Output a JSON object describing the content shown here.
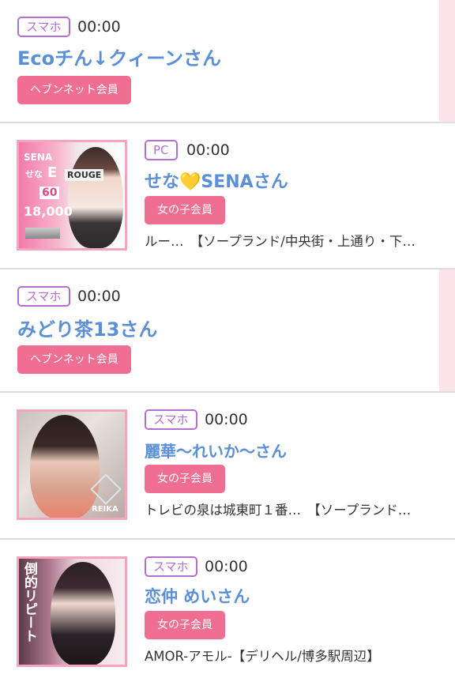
{
  "accent_color": "#f06e92",
  "name_color": "#5b8fd6",
  "badge_color": "#b46fd2",
  "entries": [
    {
      "device": "スマホ",
      "time": "00:00",
      "name": "Ecoチん↓クィーンさん",
      "member": "ヘブンネット会員",
      "shop": ""
    },
    {
      "device": "PC",
      "time": "00:00",
      "name": "せな💛SENAさん",
      "member": "女の子会員",
      "shop": "ルー…　【ソープランド/中央街・上通り・下…",
      "thumb_text": [
        "SENA",
        "せな",
        "E",
        "ROUGE",
        "60",
        "18,000"
      ]
    },
    {
      "device": "スマホ",
      "time": "00:00",
      "name": "みどり茶13さん",
      "member": "ヘブンネット会員",
      "shop": ""
    },
    {
      "device": "スマホ",
      "time": "00:00",
      "name": "麗華〜れいか〜さん",
      "member": "女の子会員",
      "shop": "トレビの泉は城東町１番…　【ソープランド…",
      "thumb_text": [
        "REIKA"
      ]
    },
    {
      "device": "スマホ",
      "time": "00:00",
      "name": "恋仲 めいさん",
      "member": "女の子会員",
      "shop": "AMOR-アモル-【デリヘル/博多駅周辺】",
      "thumb_text": [
        "倒的リピート"
      ]
    }
  ]
}
